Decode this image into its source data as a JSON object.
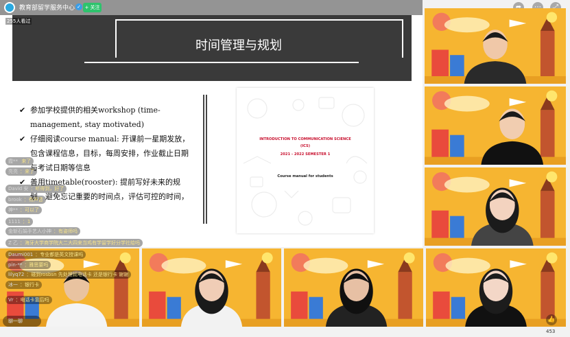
{
  "header": {
    "channel_name": "教育部留学服务中心",
    "verified_icon": "verified-icon",
    "follow_label": "+ 关注",
    "viewers": "255人看过"
  },
  "top_icons": [
    "share-icon",
    "more-icon",
    "fullscreen-icon"
  ],
  "slide": {
    "title": "时间管理与规划",
    "bullets": [
      "参加学校提供的相关workshop (time-management, stay motivated)",
      "仔细阅读course manual: 开课前一星期发放，包含课程信息，目标，每周安排，作业截止日期与考试日期等信息",
      "善用timetable(rooster): 提前写好未来的规划，避免忘记重要的时间点，评估可控的时间，"
    ],
    "tick": "✔",
    "document": {
      "title": "INTRODUCTION TO COMMUNICATION SCIENCE",
      "abbr": "(ICS)",
      "semester": "2021 - 2022 SEMESTER 1",
      "subtitle": "Course manual for students"
    }
  },
  "chat": [
    {
      "user": "霞** ",
      "msg": "来了"
    },
    {
      "user": "亮亮",
      "msg": "：来了"
    },
    {
      "user": "David 安",
      "msg": "：听得到，好了"
    },
    {
      "user": "brook",
      "msg": "：有声音"
    },
    {
      "user": "神**",
      "msg": "：可以了"
    },
    {
      "user": "1111",
      "msg": "：1"
    },
    {
      "user": "金斩石娟手艺人小神",
      "msg": "：有姿师吗"
    },
    {
      "user": "Z 乙",
      "msg": "：海牙大学商学院大二大四来当鸡有学留学好分学社给吗"
    },
    {
      "user": "Daumi001",
      "msg": "：专业都是英文授课吗"
    },
    {
      "user": "pin-**",
      "msg": "：雅思要吗"
    },
    {
      "user": "lilyq72",
      "msg": "：碰到rosbsn 先处理就电话卡 还是银行卡 谢谢"
    },
    {
      "user": "冰一",
      "msg": "：银行卡"
    },
    {
      "user": "Vr",
      "msg": "：电话卡靠后吗"
    }
  ],
  "footer": {
    "comment_placeholder": "聊一聊",
    "like_icon": "thumbs-up-icon",
    "like_count": "453"
  },
  "colors": {
    "slide_header": "#3a3a3a",
    "tile_bg": "#f6b531",
    "doc_red": "#c8102e",
    "follow_green": "#2ec36d"
  }
}
